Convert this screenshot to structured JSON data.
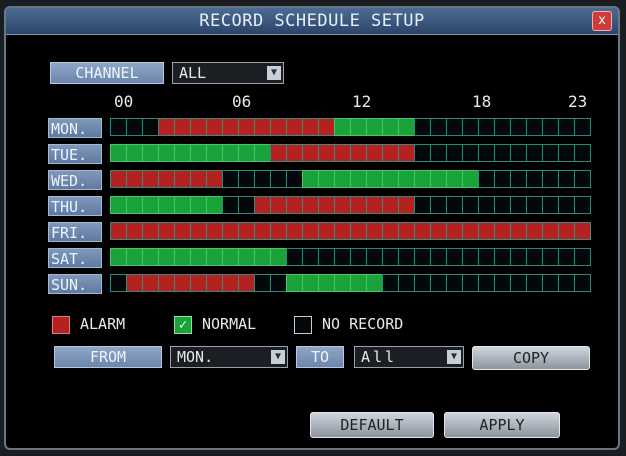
{
  "window": {
    "title": "RECORD SCHEDULE SETUP",
    "close": "x"
  },
  "channel": {
    "label": "CHANNEL",
    "value": "ALL"
  },
  "hours": [
    "00",
    "06",
    "12",
    "18",
    "23"
  ],
  "days": [
    {
      "label": "MON.",
      "cells": "NNNAAAAAAAAAAAGGGGGNNNNNNNNNNN"
    },
    {
      "label": "TUE.",
      "cells": "GGGGGGGGGGAAAAAAAAANNNNNNNNNNN"
    },
    {
      "label": "WED.",
      "cells": "AAAAAAANNNNNGGGGGGGGGGGNNNNNNN"
    },
    {
      "label": "THU.",
      "cells": "GGGGGGGNNAAAAAAAAAANNNNNNNNNNN"
    },
    {
      "label": "FRI.",
      "cells": "AAAAAAAAAAAAAAAAAAAAAAAAAAAAAA"
    },
    {
      "label": "SAT.",
      "cells": "GGGGGGGGGGGNNNNNNNNNNNNNNNNNNN"
    },
    {
      "label": "SUN.",
      "cells": "NAAAAAAAANNGGGGGGNNNNNNNNNNNNN"
    }
  ],
  "legend": {
    "alarm": "ALARM",
    "normal": "NORMAL",
    "no_record": "NO RECORD",
    "check_glyph": "✓"
  },
  "copy_row": {
    "from_label": "FROM",
    "from_value": "MON.",
    "to_label": "TO",
    "to_value": "All",
    "copy_button": "COPY"
  },
  "buttons": {
    "default": "DEFAULT",
    "apply": "APPLY"
  },
  "colors": {
    "alarm": "#b42121",
    "normal": "#1aa33a",
    "none": "#05080a",
    "title_bar": "#3a567d"
  }
}
